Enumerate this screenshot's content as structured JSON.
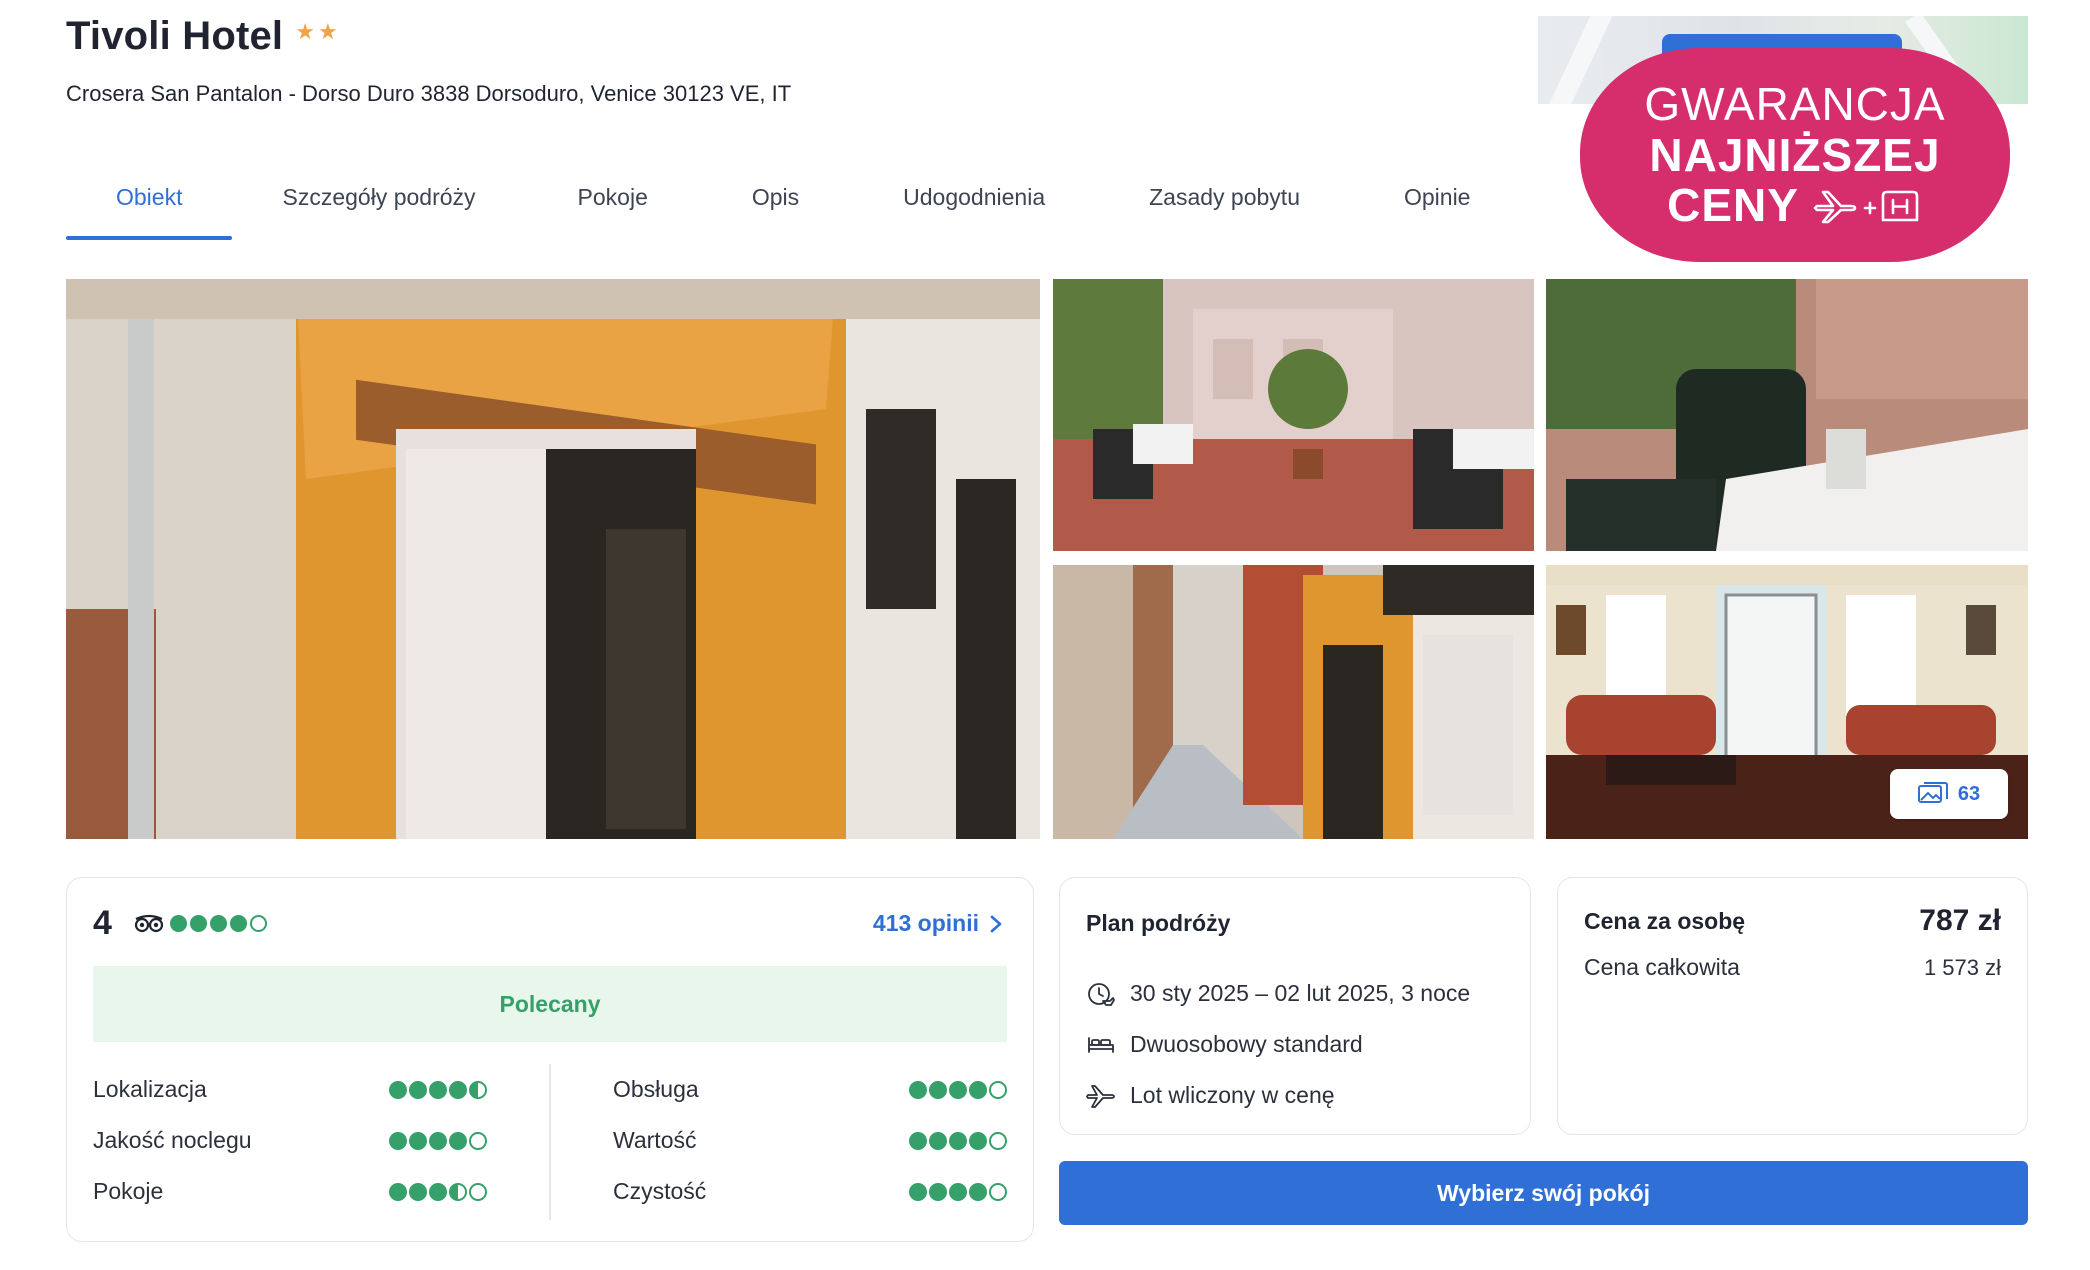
{
  "hotel": {
    "name": "Tivoli Hotel",
    "stars": 2,
    "address": "Crosera San Pantalon - Dorso Duro 3838 Dorsoduro, Venice 30123 VE, IT"
  },
  "tabs": [
    {
      "label": "Obiekt",
      "active": true
    },
    {
      "label": "Szczegóły podróży",
      "active": false
    },
    {
      "label": "Pokoje",
      "active": false
    },
    {
      "label": "Opis",
      "active": false
    },
    {
      "label": "Udogodnienia",
      "active": false
    },
    {
      "label": "Zasady pobytu",
      "active": false
    },
    {
      "label": "Opinie",
      "active": false
    }
  ],
  "badge": {
    "line1": "GWARANCJA",
    "line2": "NAJNIŻSZEJ",
    "line3": "CENY",
    "icon": "plane-plus-hotel-icon",
    "color": "#d62e6d"
  },
  "gallery": {
    "photo_count": "63",
    "icon": "photos-icon"
  },
  "rating": {
    "score": "4",
    "provider_icon": "tripadvisor-owl-icon",
    "dots": 4,
    "reviews_link": "413 opinii",
    "recommended": "Polecany",
    "categories": [
      {
        "label": "Lokalizacja",
        "value": 4.5
      },
      {
        "label": "Jakość noclegu",
        "value": 4
      },
      {
        "label": "Pokoje",
        "value": 3.5
      },
      {
        "label": "Obsługa",
        "value": 4
      },
      {
        "label": "Wartość",
        "value": 4
      },
      {
        "label": "Czystość",
        "value": 4
      }
    ]
  },
  "trip_plan": {
    "title": "Plan podróży",
    "items": [
      {
        "icon": "calendar-plane-icon",
        "text": "30 sty 2025 – 02 lut 2025, 3 noce"
      },
      {
        "icon": "bed-icon",
        "text": "Dwuosobowy standard"
      },
      {
        "icon": "plane-icon",
        "text": "Lot wliczony w cenę"
      }
    ]
  },
  "price": {
    "per_person_label": "Cena za osobę",
    "per_person_value": "787 zł",
    "total_label": "Cena całkowita",
    "total_value": "1 573 zł"
  },
  "cta": {
    "label": "Wybierz swój pokój"
  },
  "colors": {
    "accent": "#2f6fd6",
    "rating_green": "#35a06a",
    "star": "#f0a446"
  }
}
